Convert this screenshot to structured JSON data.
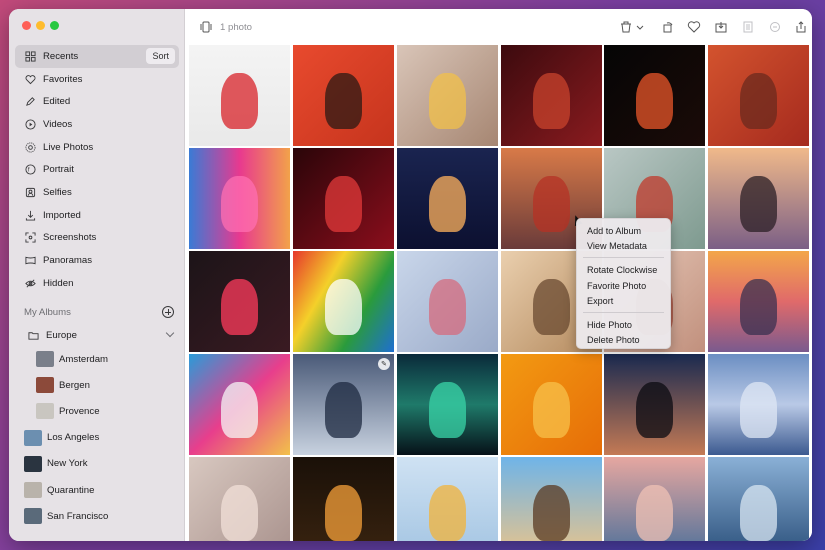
{
  "sidebar": {
    "items": [
      {
        "label": "Recents",
        "icon": "grid-icon",
        "active": true
      },
      {
        "label": "Favorites",
        "icon": "heart-icon"
      },
      {
        "label": "Edited",
        "icon": "pencil-icon"
      },
      {
        "label": "Videos",
        "icon": "play-circle-icon"
      },
      {
        "label": "Live Photos",
        "icon": "live-photo-icon"
      },
      {
        "label": "Portrait",
        "icon": "portrait-icon"
      },
      {
        "label": "Selfies",
        "icon": "selfie-icon"
      },
      {
        "label": "Imported",
        "icon": "import-icon"
      },
      {
        "label": "Screenshots",
        "icon": "screenshot-icon"
      },
      {
        "label": "Panoramas",
        "icon": "panorama-icon"
      },
      {
        "label": "Hidden",
        "icon": "eye-slash-icon"
      }
    ],
    "sort_label": "Sort",
    "albums_header": "My Albums",
    "folder": "Europe",
    "sub_albums": [
      {
        "label": "Amsterdam",
        "thumb": "#7a7f8a"
      },
      {
        "label": "Bergen",
        "thumb": "#8c4a3a"
      },
      {
        "label": "Provence",
        "thumb": "#c9c6c0"
      }
    ],
    "albums": [
      {
        "label": "Los Angeles",
        "thumb": "#6c8fb0"
      },
      {
        "label": "New York",
        "thumb": "#2a3440"
      },
      {
        "label": "Quarantine",
        "thumb": "#b9b3ab"
      },
      {
        "label": "San Francisco",
        "thumb": "#5a6a7a"
      }
    ]
  },
  "toolbar": {
    "photo_count": "1 photo",
    "icons": [
      "slideshow-icon",
      "trash-icon",
      "rotate-icon",
      "heart-icon",
      "add-to-album-icon",
      "info-icon",
      "revert-icon",
      "share-icon"
    ]
  },
  "context_menu": {
    "groups": [
      [
        "Add to Album",
        "View Metadata"
      ],
      [
        "Rotate Clockwise",
        "Favorite Photo",
        "Export"
      ],
      [
        "Hide Photo",
        "Delete Photo"
      ]
    ]
  },
  "photos": [
    {
      "row": 0,
      "col": 0,
      "bg": "linear-gradient(180deg,#f4f4f4,#e9e9e9)",
      "accent": "#d8232a"
    },
    {
      "row": 0,
      "col": 1,
      "bg": "linear-gradient(135deg,#e84a2e,#c6341d)",
      "accent": "#2b1a14"
    },
    {
      "row": 0,
      "col": 2,
      "bg": "linear-gradient(135deg,#d9c5b8,#a68672)",
      "accent": "#f2c04a"
    },
    {
      "row": 0,
      "col": 3,
      "bg": "linear-gradient(135deg,#3c0a0e,#8a1b1f)",
      "accent": "#c8432c"
    },
    {
      "row": 0,
      "col": 4,
      "bg": "linear-gradient(135deg,#050505,#1b0b08)",
      "accent": "#e8562a"
    },
    {
      "row": 0,
      "col": 5,
      "bg": "linear-gradient(135deg,#d3532e,#a52a1e)",
      "accent": "#6b2a1e"
    },
    {
      "row": 1,
      "col": 0,
      "bg": "linear-gradient(90deg,#3a7bd5,#e8398f,#f2a24a)",
      "accent": "#ff6fb1"
    },
    {
      "row": 1,
      "col": 1,
      "bg": "linear-gradient(135deg,#2a0509,#8b0e1c)",
      "accent": "#e23a3a"
    },
    {
      "row": 1,
      "col": 2,
      "bg": "linear-gradient(180deg,#1a2450,#0c1030)",
      "accent": "#ffb25c"
    },
    {
      "row": 1,
      "col": 3,
      "bg": "linear-gradient(180deg,#d87a48,#6a3b3a)",
      "accent": "#b53224"
    },
    {
      "row": 1,
      "col": 4,
      "bg": "linear-gradient(135deg,#b9c7c4,#7e9a8f)",
      "accent": "#c0392b"
    },
    {
      "row": 1,
      "col": 5,
      "bg": "linear-gradient(180deg,#f0b98a,#7b5f86)",
      "accent": "#2b1f26"
    },
    {
      "row": 2,
      "col": 0,
      "bg": "linear-gradient(135deg,#1c1418,#3a1a22)",
      "accent": "#ff3b5c"
    },
    {
      "row": 2,
      "col": 1,
      "bg": "linear-gradient(120deg,#e6372b,#f4d02a,#2a9b3c,#1f6fd1)",
      "accent": "#ffffff"
    },
    {
      "row": 2,
      "col": 2,
      "bg": "linear-gradient(135deg,#c9d6ea,#9aaac8)",
      "accent": "#d66b7e"
    },
    {
      "row": 2,
      "col": 3,
      "bg": "linear-gradient(135deg,#eacfae,#b48a5e)",
      "accent": "#6a4a30"
    },
    {
      "row": 2,
      "col": 4,
      "bg": "linear-gradient(135deg,#e7c9b9,#c1907d)",
      "accent": "#a34a3a"
    },
    {
      "row": 2,
      "col": 5,
      "bg": "linear-gradient(180deg,#f3a64a,#e06a6a,#7a5a8e)",
      "accent": "#3a3050"
    },
    {
      "row": 3,
      "col": 0,
      "bg": "linear-gradient(135deg,#2a9bd8,#e83e8c,#f2c14a)",
      "accent": "#f5f5f5"
    },
    {
      "row": 3,
      "col": 1,
      "bg": "linear-gradient(180deg,#4a5a78,#c8d2e0)",
      "accent": "#1e2a40"
    },
    {
      "row": 3,
      "col": 2,
      "bg": "linear-gradient(180deg,#0a2a3a,#1f7a6a,#061018)",
      "accent": "#3ad6a8"
    },
    {
      "row": 3,
      "col": 3,
      "bg": "linear-gradient(135deg,#f39a12,#e66d07)",
      "accent": "#f7c04a"
    },
    {
      "row": 3,
      "col": 4,
      "bg": "linear-gradient(180deg,#1a2a50,#c47a55)",
      "accent": "#0b0b12"
    },
    {
      "row": 3,
      "col": 5,
      "bg": "linear-gradient(180deg,#6b8ec2,#b9c9e6,#3c5a90)",
      "accent": "#dfe7f4"
    },
    {
      "row": 4,
      "col": 0,
      "bg": "linear-gradient(135deg,#d8c8c0,#a8918c)",
      "accent": "#f2e0d8"
    },
    {
      "row": 4,
      "col": 1,
      "bg": "linear-gradient(180deg,#1a1008,#3a2410)",
      "accent": "#f5a03a"
    },
    {
      "row": 4,
      "col": 2,
      "bg": "linear-gradient(180deg,#cfe2f3,#a3c4e2)",
      "accent": "#f2b33a"
    },
    {
      "row": 4,
      "col": 3,
      "bg": "linear-gradient(180deg,#6fb4e8,#eac48a)",
      "accent": "#5a3a22"
    },
    {
      "row": 4,
      "col": 4,
      "bg": "linear-gradient(180deg,#e6a7a0,#4a6f9a)",
      "accent": "#f0c2b4"
    },
    {
      "row": 4,
      "col": 5,
      "bg": "linear-gradient(180deg,#8ab0d6,#2a4f7a)",
      "accent": "#d8e6f2"
    }
  ]
}
